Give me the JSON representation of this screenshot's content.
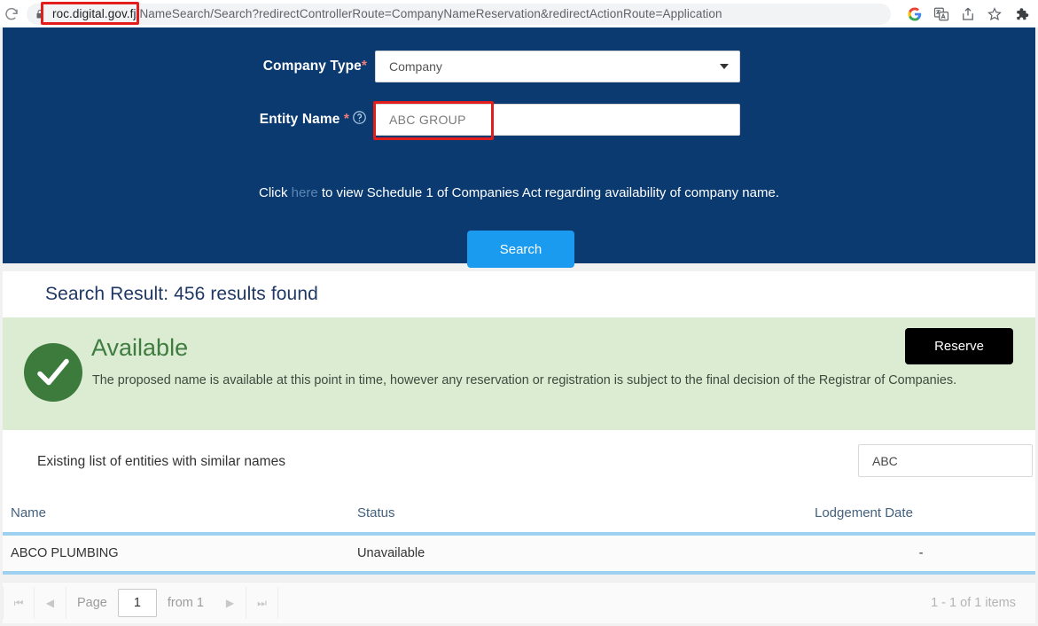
{
  "browser": {
    "url_host": "roc.digital.gov.fj",
    "url_path": "/NameSearch/Search?redirectControllerRoute=CompanyNameReservation&redirectActionRoute=Application",
    "icons": {
      "reload": "reload-icon",
      "lock": "lock-icon",
      "google": "google-icon",
      "translate": "translate-icon",
      "share": "share-icon",
      "bookmark": "bookmark-star-icon",
      "extensions": "extensions-puzzle-icon"
    },
    "annotation_color": "#e31c1c"
  },
  "search_form": {
    "company_type": {
      "label": "Company Type",
      "required_marker": "*",
      "value": "Company"
    },
    "entity_name": {
      "label": "Entity Name",
      "required_marker": "*",
      "help_icon": "question-circle-icon",
      "value": "ABC GROUP"
    },
    "hint": {
      "before": "Click ",
      "link": "here",
      "after": " to view Schedule 1 of Companies Act regarding availability of company name."
    },
    "search_button": "Search",
    "panel_color": "#0a3a70",
    "button_color": "#1a9bf0"
  },
  "results": {
    "heading": "Search Result: 456 results found",
    "availability": {
      "status": "Available",
      "icon": "check-circle-icon",
      "message": "The proposed name is available at this point in time, however any reservation or registration is subject to the final decision of the Registrar of Companies.",
      "reserve_button": "Reserve",
      "band_color": "#dcecd3",
      "status_color": "#3f7c3f"
    },
    "similar_list": {
      "caption": "Existing list of entities with similar names",
      "filter_value": "ABC",
      "columns": [
        "Name",
        "Status",
        "Lodgement Date"
      ],
      "rows": [
        {
          "name": "ABCO PLUMBING",
          "status": "Unavailable",
          "lodgement_date": "-"
        }
      ]
    },
    "pager": {
      "first": "⏮",
      "prev": "◀",
      "page_label": "Page",
      "page_value": "1",
      "from_label": "from 1",
      "next": "▶",
      "last": "⏭",
      "summary": "1 - 1 of 1 items"
    }
  }
}
